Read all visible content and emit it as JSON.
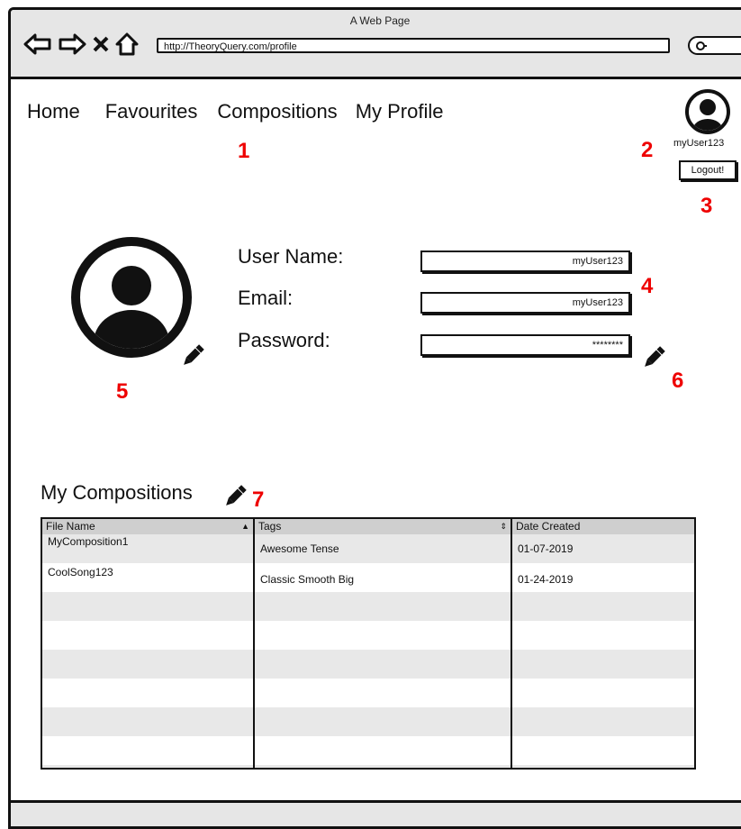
{
  "window": {
    "title": "A Web Page",
    "url": "http://TheoryQuery.com/profile"
  },
  "nav": {
    "items": [
      "Home",
      "Favourites",
      "Compositions",
      "My Profile"
    ]
  },
  "user": {
    "username": "myUser123",
    "logout_label": "Logout!"
  },
  "profile": {
    "fields": [
      {
        "label": "User Name:",
        "value": "myUser123"
      },
      {
        "label": "Email:",
        "value": "myUser123"
      },
      {
        "label": "Password:",
        "value": "********"
      }
    ]
  },
  "compositions": {
    "title": "My Compositions",
    "columns": [
      "File Name",
      "Tags",
      "Date Created"
    ],
    "rows": [
      {
        "file": "MyComposition1",
        "tags": "Awesome Tense",
        "date": "01-07-2019"
      },
      {
        "file": "CoolSong123",
        "tags": "Classic Smooth Big",
        "date": "01-24-2019"
      }
    ]
  },
  "annotations": [
    "1",
    "2",
    "3",
    "4",
    "5",
    "6",
    "7"
  ],
  "colors": {
    "annotation": "#e00000",
    "chrome": "#e6e6e6",
    "stripe": "#e8e8e8"
  },
  "icons": [
    "back-arrow-icon",
    "forward-arrow-icon",
    "close-icon",
    "home-icon",
    "search-icon",
    "user-avatar-icon",
    "pencil-icon",
    "sort-asc-icon",
    "sort-updown-icon"
  ]
}
